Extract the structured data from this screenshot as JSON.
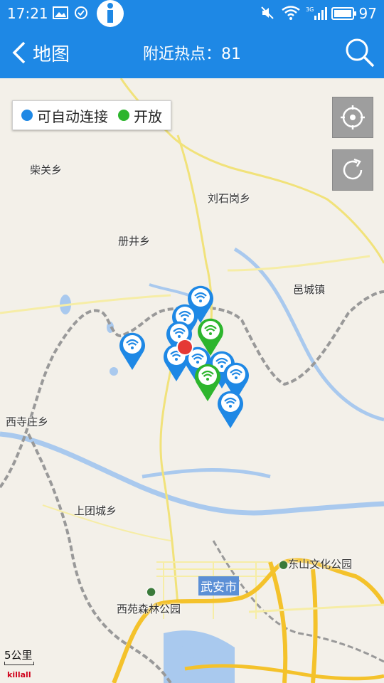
{
  "status_bar": {
    "time": "17:21",
    "battery": "97"
  },
  "app_bar": {
    "back_label": "地图",
    "hotspot_label": "附近热点：81"
  },
  "legend": [
    {
      "label": "可自动连接",
      "color": "#1e88e5"
    },
    {
      "label": "开放",
      "color": "#2db52d"
    }
  ],
  "places": [
    {
      "name": "柴关乡"
    },
    {
      "name": "刘石岗乡"
    },
    {
      "name": "册井乡"
    },
    {
      "name": "邑城镇"
    },
    {
      "name": "西寺庄乡"
    },
    {
      "name": "上团城乡"
    },
    {
      "name": "东山文化公园"
    },
    {
      "name": "西苑森林公园"
    }
  ],
  "city_label": "武安市",
  "scale_label": "5公里",
  "watermark": "killall",
  "colors": {
    "primary": "#1e88e5",
    "open": "#2db52d",
    "self": "#e53935"
  },
  "icons": [
    "back-arrow-icon",
    "search-icon",
    "locate-icon",
    "refresh-icon",
    "wifi-icon"
  ]
}
